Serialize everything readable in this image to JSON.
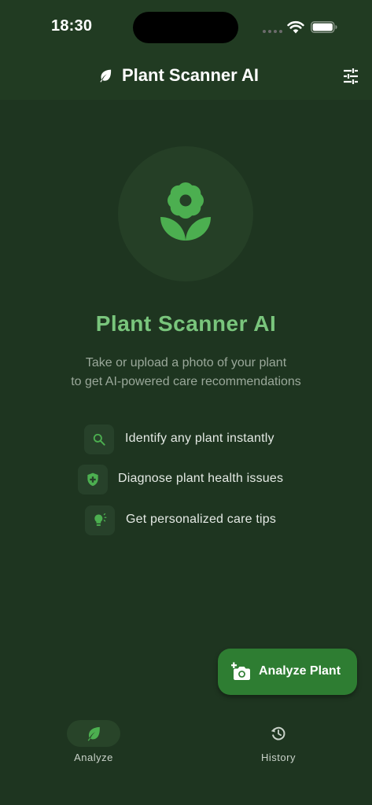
{
  "status_bar": {
    "time": "18:30",
    "icons": [
      "signal-icon",
      "wifi-icon",
      "battery-icon"
    ]
  },
  "app_bar": {
    "title": "Plant Scanner AI",
    "leading_icon": "leaf-icon",
    "trailing_icon": "settings-icon"
  },
  "hero": {
    "icon": "flower-icon",
    "title": "Plant Scanner AI",
    "subtitle_line1": "Take or upload a photo of your plant",
    "subtitle_line2": "to get AI-powered care recommendations"
  },
  "features": [
    {
      "icon": "search-icon",
      "label": "Identify any plant instantly"
    },
    {
      "icon": "shield-health-icon",
      "label": "Diagnose plant health issues"
    },
    {
      "icon": "lightbulb-icon",
      "label": "Get personalized care tips"
    }
  ],
  "fab": {
    "icon": "add-camera-icon",
    "label": "Analyze Plant"
  },
  "bottom_nav": {
    "items": [
      {
        "icon": "leaf-icon",
        "label": "Analyze",
        "selected": true
      },
      {
        "icon": "history-icon",
        "label": "History",
        "selected": false
      }
    ]
  },
  "colors": {
    "background": "#1e3520",
    "app_bar": "#213b22",
    "accent": "#2e7d32",
    "title_green": "#79c57c",
    "icon_green": "#4caf50"
  }
}
